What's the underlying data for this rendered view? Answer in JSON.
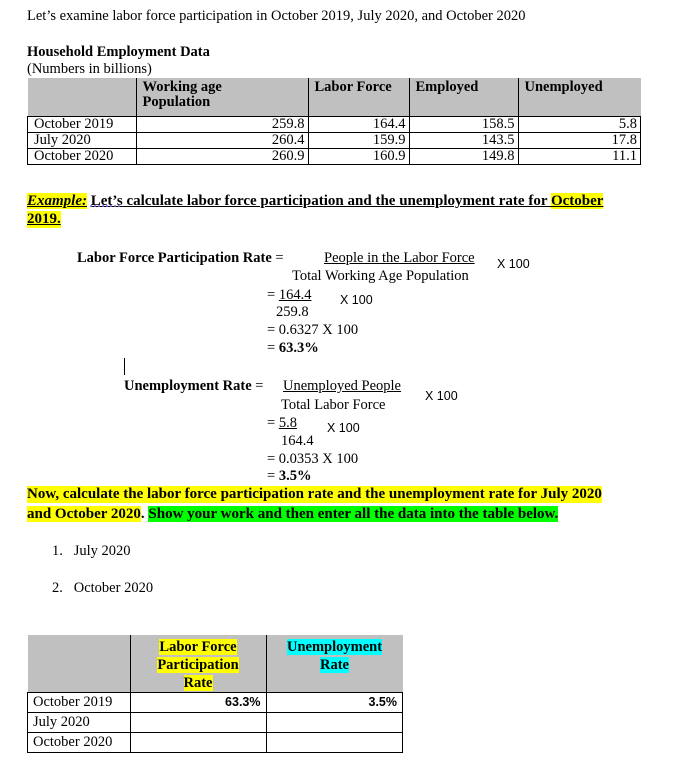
{
  "intro": "Let’s examine labor force participation in October 2019, July 2020, and October 2020",
  "household": {
    "title": "Household Employment Data",
    "subtitle": "(Numbers in billions)",
    "headers": [
      "",
      "Working age Population",
      "Labor Force",
      "Employed",
      "Unemployed"
    ],
    "header_line1": "Working age",
    "header_line2": "Population",
    "rows": [
      {
        "label": "October 2019",
        "working_age": "259.8",
        "labor_force": "164.4",
        "employed": "158.5",
        "unemployed": "5.8"
      },
      {
        "label": "July 2020",
        "working_age": "260.4",
        "labor_force": "159.9",
        "employed": "143.5",
        "unemployed": "17.8"
      },
      {
        "label": "October 2020",
        "working_age": "260.9",
        "labor_force": "160.9",
        "employed": "149.8",
        "unemployed": "11.1"
      }
    ]
  },
  "example": {
    "label": "Example:",
    "heading_part1": "Let’s",
    "heading_part2": " calculate labor force participation and the unemployment rate for ",
    "heading_highlight": "October",
    "heading_line2": "2019."
  },
  "lfpr": {
    "label": "Labor Force Participation Rate",
    "eq": " = ",
    "numerator": "People in the Labor Force",
    "denominator": "Total Working Age Population",
    "times": "X 100",
    "step1_eq": "= ",
    "step1_num": "164.4",
    "step1_den": "259.8",
    "step1_times": "X 100",
    "step2": "= 0.6327 X 100",
    "result_eq": "= ",
    "result": "63.3%"
  },
  "ur": {
    "label": "Unemployment Rate",
    "eq": " = ",
    "numerator": "Unemployed People",
    "denominator": "Total Labor Force",
    "times": "X 100",
    "step1_eq": "= ",
    "step1_num": "5.8",
    "step1_den": "164.4",
    "step1_times": "X 100",
    "step2": "= 0.0353 X 100",
    "result_eq": "= ",
    "result": "3.5%"
  },
  "instruction": {
    "yellow_line1": "Now, calculate the labor force participation rate and the unemployment rate for July 2020",
    "yellow_line2": "and October 2020",
    "period": ". ",
    "green": "Show your work and then enter all the data into the table below."
  },
  "list": [
    {
      "num": "1.",
      "text": "July 2020"
    },
    {
      "num": "2.",
      "text": "October 2020"
    }
  ],
  "results": {
    "col1_l1": "Labor Force",
    "col1_l2": "Participation",
    "col1_l3": "Rate",
    "col2_l1": "Unemployment",
    "col2_l2": "Rate",
    "rows": [
      {
        "label": "October 2019",
        "lfpr": "63.3%",
        "ur": "3.5%"
      },
      {
        "label": "July 2020",
        "lfpr": "",
        "ur": ""
      },
      {
        "label": "October 2020",
        "lfpr": "",
        "ur": ""
      }
    ]
  },
  "colors": {
    "yellow_highlight": "#ffff00",
    "green_highlight": "#00ff00",
    "cyan_highlight": "#00ffff",
    "table_header_gray": "#c0c0c0"
  }
}
